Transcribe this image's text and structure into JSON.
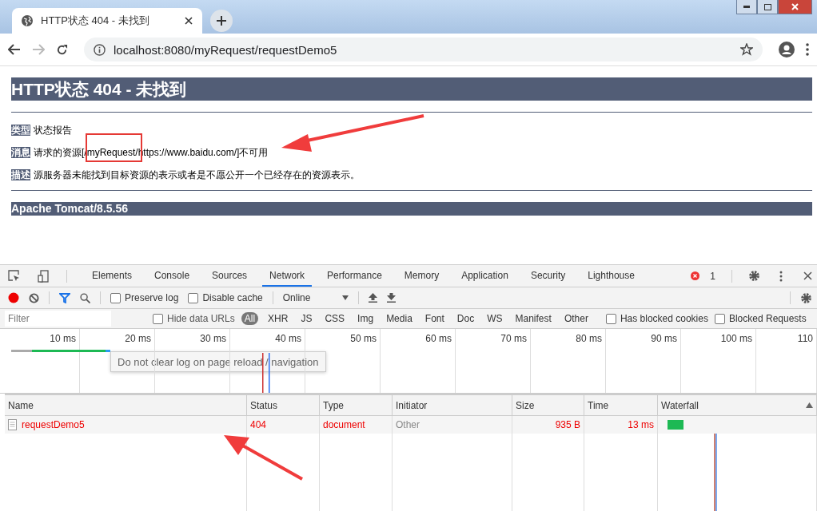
{
  "browser": {
    "tab": {
      "title": "HTTP状态 404 - 未找到"
    },
    "address": "localhost:8080/myRequest/requestDemo5"
  },
  "page": {
    "heading": "HTTP状态 404 - 未找到",
    "fields": [
      {
        "label": "类型",
        "text": "状态报告"
      },
      {
        "label": "消息",
        "text": "请求的资源[/myRequest/https://www.baidu.com/]不可用"
      },
      {
        "label": "描述",
        "text": "源服务器未能找到目标资源的表示或者是不愿公开一个已经存在的资源表示。"
      }
    ],
    "footer": "Apache Tomcat/8.5.56"
  },
  "devtools": {
    "tabs": [
      {
        "label": "Elements",
        "selected": false
      },
      {
        "label": "Console",
        "selected": false
      },
      {
        "label": "Sources",
        "selected": false
      },
      {
        "label": "Network",
        "selected": true
      },
      {
        "label": "Performance",
        "selected": false
      },
      {
        "label": "Memory",
        "selected": false
      },
      {
        "label": "Application",
        "selected": false
      },
      {
        "label": "Security",
        "selected": false
      },
      {
        "label": "Lighthouse",
        "selected": false
      }
    ],
    "error_count": "1",
    "toolbar": {
      "recording": true,
      "preserve_log": {
        "label": "Preserve log",
        "checked": false
      },
      "disable_cache": {
        "label": "Disable cache",
        "checked": false
      },
      "throttle": "Online"
    },
    "filter": {
      "placeholder": "Filter",
      "hide_data_urls": {
        "label": "Hide data URLs",
        "checked": false
      },
      "types": [
        {
          "label": "All",
          "selected": true
        },
        {
          "label": "XHR",
          "selected": false
        },
        {
          "label": "JS",
          "selected": false
        },
        {
          "label": "CSS",
          "selected": false
        },
        {
          "label": "Img",
          "selected": false
        },
        {
          "label": "Media",
          "selected": false
        },
        {
          "label": "Font",
          "selected": false
        },
        {
          "label": "Doc",
          "selected": false
        },
        {
          "label": "WS",
          "selected": false
        },
        {
          "label": "Manifest",
          "selected": false
        },
        {
          "label": "Other",
          "selected": false
        }
      ],
      "has_blocked_cookies": {
        "label": "Has blocked cookies",
        "checked": false
      },
      "blocked_requests": {
        "label": "Blocked Requests",
        "checked": false
      }
    },
    "tooltip": "Do not clear log on page reload / navigation",
    "overview_ticks": [
      "10 ms",
      "20 ms",
      "30 ms",
      "40 ms",
      "50 ms",
      "60 ms",
      "70 ms",
      "80 ms",
      "90 ms",
      "100 ms",
      "110"
    ],
    "table": {
      "columns": [
        "Name",
        "Status",
        "Type",
        "Initiator",
        "Size",
        "Time",
        "Waterfall"
      ],
      "rows": [
        {
          "name": "requestDemo5",
          "status": "404",
          "type": "document",
          "initiator": "Other",
          "size": "935 B",
          "time": "13 ms",
          "failed": true
        }
      ]
    }
  }
}
